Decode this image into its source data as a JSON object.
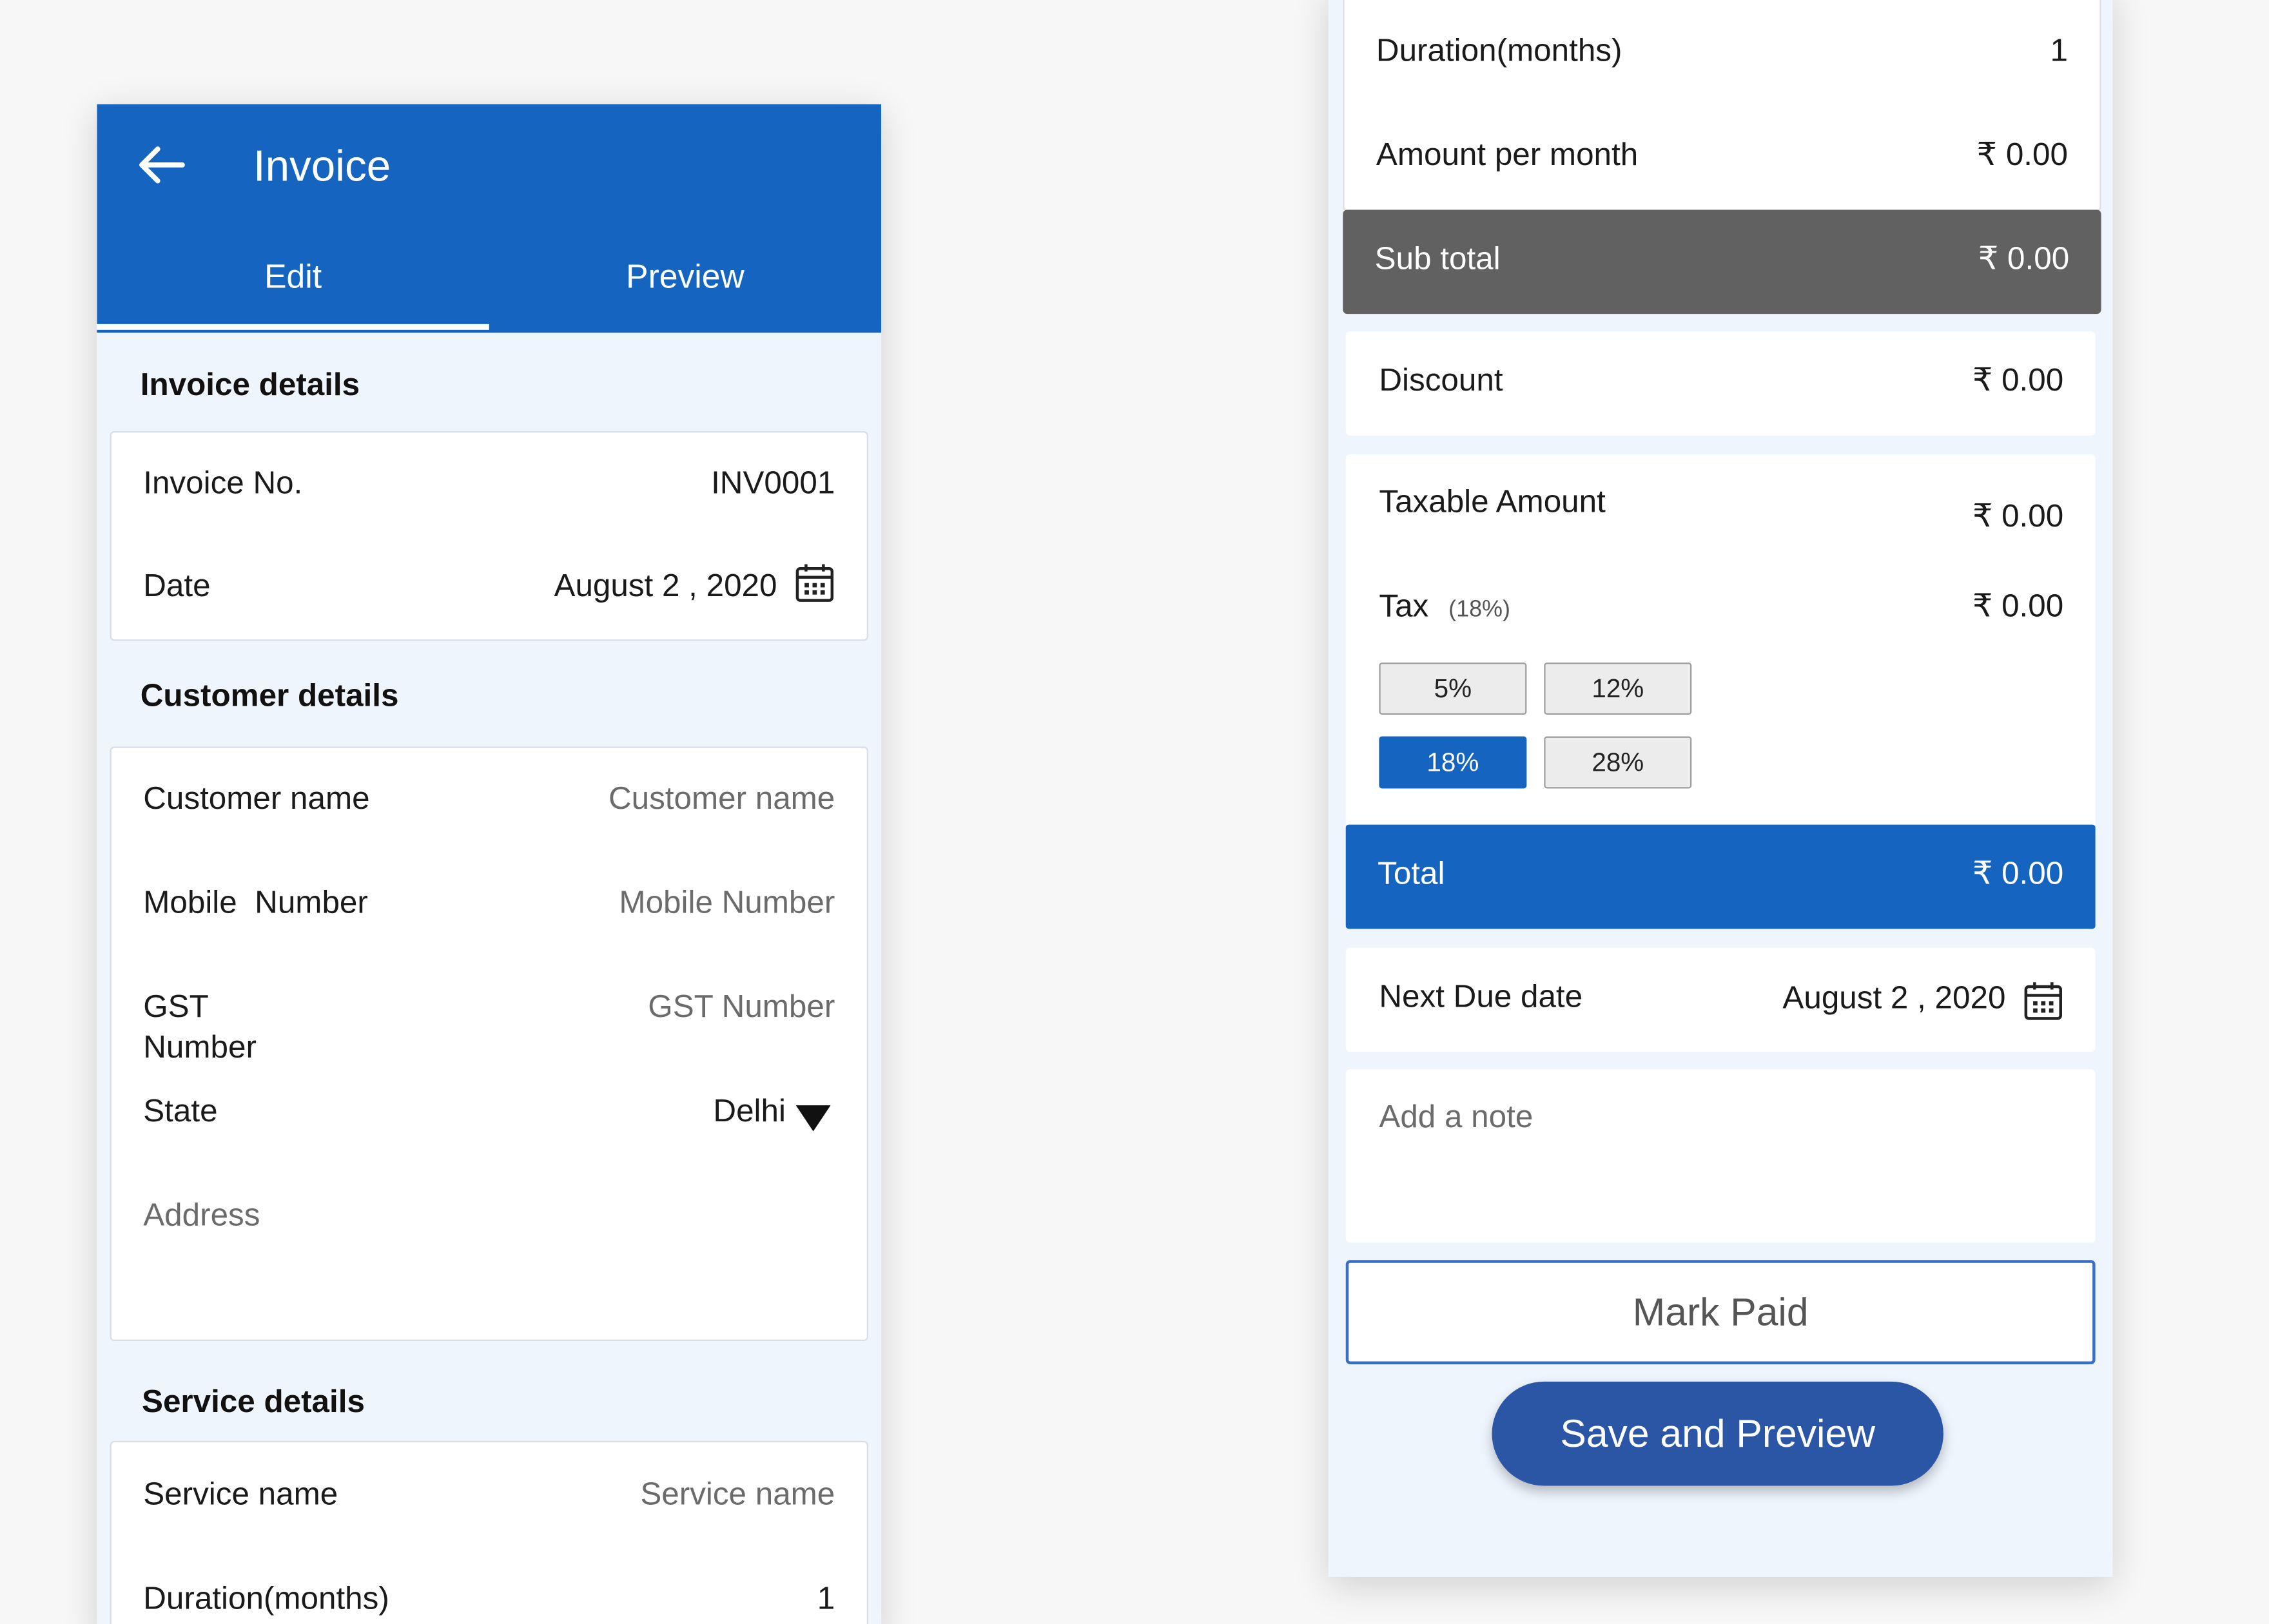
{
  "left_screen": {
    "appbar": {
      "title": "Invoice",
      "back_icon": "arrow-left-icon"
    },
    "tabs": [
      {
        "label": "Edit",
        "active": true
      },
      {
        "label": "Preview",
        "active": false
      }
    ],
    "invoice_details": {
      "title": "Invoice details",
      "invoice_no_label": "Invoice No.",
      "invoice_no_value": "INV0001",
      "date_label": "Date",
      "date_value": "August 2 , 2020"
    },
    "customer_details": {
      "title": "Customer details",
      "name_label": "Customer name",
      "name_placeholder": "Customer name",
      "mobile_label": "Mobile  Number",
      "mobile_placeholder": "Mobile Number",
      "gst_label_line1": "GST",
      "gst_label_line2": "Number",
      "gst_placeholder": "GST Number",
      "state_label": "State",
      "state_value": "Delhi",
      "address_placeholder": "Address"
    },
    "service_details": {
      "title": "Service details",
      "service_label": "Service name",
      "service_placeholder": "Service name",
      "duration_label": "Duration(months)",
      "duration_value": "1"
    }
  },
  "right_screen": {
    "duration_label": "Duration(months)",
    "duration_value": "1",
    "amount_label": "Amount per month",
    "amount_value": "₹ 0.00",
    "subtotal_label": "Sub total",
    "subtotal_value": "₹ 0.00",
    "discount_label": "Discount",
    "discount_value": "₹ 0.00",
    "taxable_label": "Taxable Amount",
    "taxable_value": "₹ 0.00",
    "tax_label": "Tax",
    "tax_rate": "(18%)",
    "tax_value": "₹ 0.00",
    "tax_options": [
      "5%",
      "12%",
      "18%",
      "28%"
    ],
    "tax_selected": "18%",
    "total_label": "Total",
    "total_value": "₹ 0.00",
    "next_due_label": "Next Due date",
    "next_due_value": "August 2 , 2020",
    "note_placeholder": "Add a note",
    "mark_paid_label": "Mark Paid",
    "save_label": "Save and Preview"
  },
  "colors": {
    "primary": "#1565c0",
    "subtotal_band": "#616161",
    "background": "#eef5fd",
    "save_button": "#2b56a6"
  }
}
